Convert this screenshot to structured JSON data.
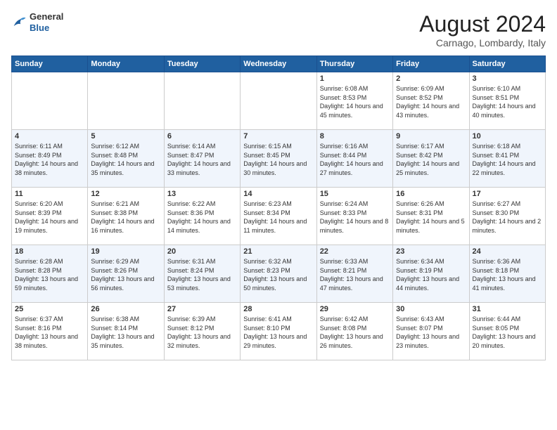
{
  "header": {
    "logo": {
      "line1": "General",
      "line2": "Blue"
    },
    "title": "August 2024",
    "subtitle": "Carnago, Lombardy, Italy"
  },
  "weekdays": [
    "Sunday",
    "Monday",
    "Tuesday",
    "Wednesday",
    "Thursday",
    "Friday",
    "Saturday"
  ],
  "weeks": [
    [
      {
        "day": "",
        "content": ""
      },
      {
        "day": "",
        "content": ""
      },
      {
        "day": "",
        "content": ""
      },
      {
        "day": "",
        "content": ""
      },
      {
        "day": "1",
        "content": "Sunrise: 6:08 AM\nSunset: 8:53 PM\nDaylight: 14 hours and 45 minutes."
      },
      {
        "day": "2",
        "content": "Sunrise: 6:09 AM\nSunset: 8:52 PM\nDaylight: 14 hours and 43 minutes."
      },
      {
        "day": "3",
        "content": "Sunrise: 6:10 AM\nSunset: 8:51 PM\nDaylight: 14 hours and 40 minutes."
      }
    ],
    [
      {
        "day": "4",
        "content": "Sunrise: 6:11 AM\nSunset: 8:49 PM\nDaylight: 14 hours and 38 minutes."
      },
      {
        "day": "5",
        "content": "Sunrise: 6:12 AM\nSunset: 8:48 PM\nDaylight: 14 hours and 35 minutes."
      },
      {
        "day": "6",
        "content": "Sunrise: 6:14 AM\nSunset: 8:47 PM\nDaylight: 14 hours and 33 minutes."
      },
      {
        "day": "7",
        "content": "Sunrise: 6:15 AM\nSunset: 8:45 PM\nDaylight: 14 hours and 30 minutes."
      },
      {
        "day": "8",
        "content": "Sunrise: 6:16 AM\nSunset: 8:44 PM\nDaylight: 14 hours and 27 minutes."
      },
      {
        "day": "9",
        "content": "Sunrise: 6:17 AM\nSunset: 8:42 PM\nDaylight: 14 hours and 25 minutes."
      },
      {
        "day": "10",
        "content": "Sunrise: 6:18 AM\nSunset: 8:41 PM\nDaylight: 14 hours and 22 minutes."
      }
    ],
    [
      {
        "day": "11",
        "content": "Sunrise: 6:20 AM\nSunset: 8:39 PM\nDaylight: 14 hours and 19 minutes."
      },
      {
        "day": "12",
        "content": "Sunrise: 6:21 AM\nSunset: 8:38 PM\nDaylight: 14 hours and 16 minutes."
      },
      {
        "day": "13",
        "content": "Sunrise: 6:22 AM\nSunset: 8:36 PM\nDaylight: 14 hours and 14 minutes."
      },
      {
        "day": "14",
        "content": "Sunrise: 6:23 AM\nSunset: 8:34 PM\nDaylight: 14 hours and 11 minutes."
      },
      {
        "day": "15",
        "content": "Sunrise: 6:24 AM\nSunset: 8:33 PM\nDaylight: 14 hours and 8 minutes."
      },
      {
        "day": "16",
        "content": "Sunrise: 6:26 AM\nSunset: 8:31 PM\nDaylight: 14 hours and 5 minutes."
      },
      {
        "day": "17",
        "content": "Sunrise: 6:27 AM\nSunset: 8:30 PM\nDaylight: 14 hours and 2 minutes."
      }
    ],
    [
      {
        "day": "18",
        "content": "Sunrise: 6:28 AM\nSunset: 8:28 PM\nDaylight: 13 hours and 59 minutes."
      },
      {
        "day": "19",
        "content": "Sunrise: 6:29 AM\nSunset: 8:26 PM\nDaylight: 13 hours and 56 minutes."
      },
      {
        "day": "20",
        "content": "Sunrise: 6:31 AM\nSunset: 8:24 PM\nDaylight: 13 hours and 53 minutes."
      },
      {
        "day": "21",
        "content": "Sunrise: 6:32 AM\nSunset: 8:23 PM\nDaylight: 13 hours and 50 minutes."
      },
      {
        "day": "22",
        "content": "Sunrise: 6:33 AM\nSunset: 8:21 PM\nDaylight: 13 hours and 47 minutes."
      },
      {
        "day": "23",
        "content": "Sunrise: 6:34 AM\nSunset: 8:19 PM\nDaylight: 13 hours and 44 minutes."
      },
      {
        "day": "24",
        "content": "Sunrise: 6:36 AM\nSunset: 8:18 PM\nDaylight: 13 hours and 41 minutes."
      }
    ],
    [
      {
        "day": "25",
        "content": "Sunrise: 6:37 AM\nSunset: 8:16 PM\nDaylight: 13 hours and 38 minutes."
      },
      {
        "day": "26",
        "content": "Sunrise: 6:38 AM\nSunset: 8:14 PM\nDaylight: 13 hours and 35 minutes."
      },
      {
        "day": "27",
        "content": "Sunrise: 6:39 AM\nSunset: 8:12 PM\nDaylight: 13 hours and 32 minutes."
      },
      {
        "day": "28",
        "content": "Sunrise: 6:41 AM\nSunset: 8:10 PM\nDaylight: 13 hours and 29 minutes."
      },
      {
        "day": "29",
        "content": "Sunrise: 6:42 AM\nSunset: 8:08 PM\nDaylight: 13 hours and 26 minutes."
      },
      {
        "day": "30",
        "content": "Sunrise: 6:43 AM\nSunset: 8:07 PM\nDaylight: 13 hours and 23 minutes."
      },
      {
        "day": "31",
        "content": "Sunrise: 6:44 AM\nSunset: 8:05 PM\nDaylight: 13 hours and 20 minutes."
      }
    ]
  ]
}
